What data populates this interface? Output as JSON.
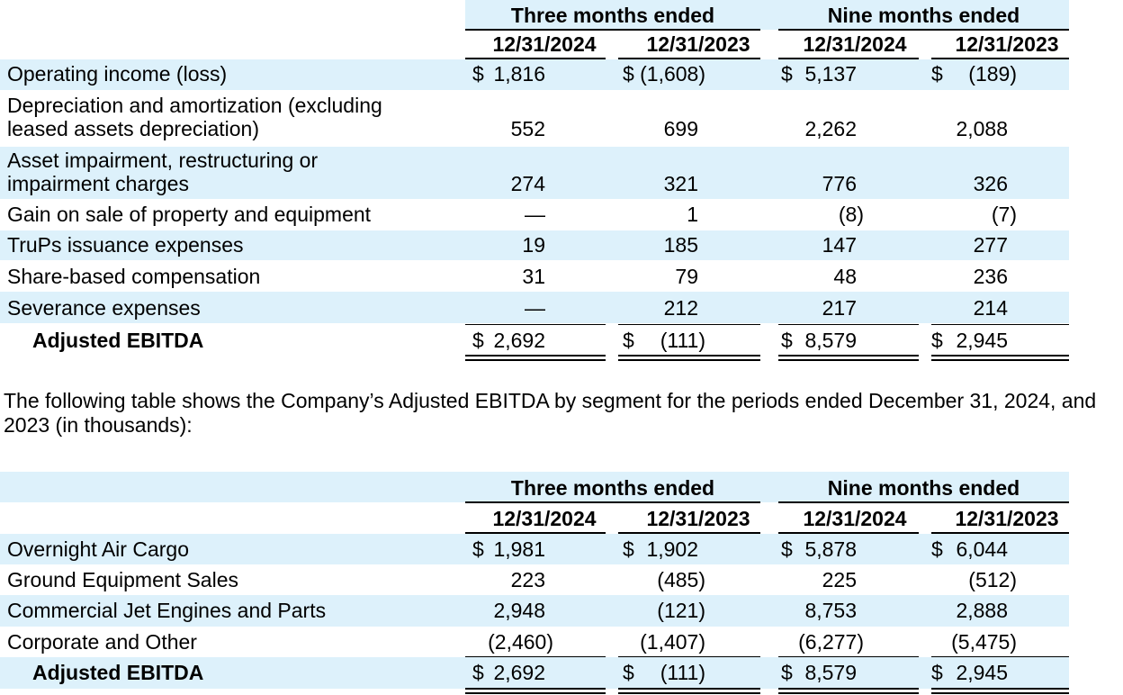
{
  "headers": {
    "three_months": "Three months ended",
    "nine_months": "Nine months ended",
    "col1": "12/31/2024",
    "col2": "12/31/2023",
    "col3": "12/31/2024",
    "col4": "12/31/2023",
    "currency": "$"
  },
  "table1": {
    "rows": [
      {
        "label": "Operating income (loss)",
        "values": [
          "1,816",
          "(1,608)",
          "5,137",
          "(189)"
        ]
      },
      {
        "label_line1": "Depreciation and amortization (excluding",
        "label_line2": "leased assets depreciation)",
        "values": [
          "552",
          "699",
          "2,262",
          "2,088"
        ]
      },
      {
        "label_line1": "Asset impairment, restructuring or",
        "label_line2": "impairment charges",
        "values": [
          "274",
          "321",
          "776",
          "326"
        ]
      },
      {
        "label": "Gain on sale of property and equipment",
        "values": [
          "—",
          "1",
          "(8)",
          "(7)"
        ]
      },
      {
        "label": "TruPs issuance expenses",
        "values": [
          "19",
          "185",
          "147",
          "277"
        ]
      },
      {
        "label": "Share-based compensation",
        "values": [
          "31",
          "79",
          "48",
          "236"
        ]
      },
      {
        "label": "Severance expenses",
        "values": [
          "—",
          "212",
          "217",
          "214"
        ]
      }
    ],
    "total": {
      "label": "Adjusted EBITDA",
      "values": [
        "2,692",
        "(111)",
        "8,579",
        "2,945"
      ]
    }
  },
  "paragraph": "The following table shows the Company’s Adjusted EBITDA by segment for the periods ended December 31, 2024, and 2023 (in thousands):",
  "table2": {
    "rows": [
      {
        "label": "Overnight Air Cargo",
        "values": [
          "1,981",
          "1,902",
          "5,878",
          "6,044"
        ]
      },
      {
        "label": "Ground Equipment Sales",
        "values": [
          "223",
          "(485)",
          "225",
          "(512)"
        ]
      },
      {
        "label": "Commercial Jet Engines and Parts",
        "values": [
          "2,948",
          "(121)",
          "8,753",
          "2,888"
        ]
      },
      {
        "label": "Corporate and Other",
        "values": [
          "(2,460)",
          "(1,407)",
          "(6,277)",
          "(5,475)"
        ]
      }
    ],
    "total": {
      "label": "Adjusted EBITDA",
      "values": [
        "2,692",
        "(111)",
        "8,579",
        "2,945"
      ]
    }
  },
  "colors": {
    "band": "#ddf1fb"
  }
}
